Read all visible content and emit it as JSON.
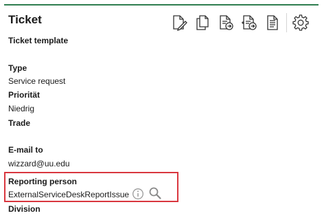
{
  "header": {
    "title": "Ticket",
    "toolbar": [
      {
        "icon": "edit-document-icon"
      },
      {
        "icon": "copy-document-icon"
      },
      {
        "icon": "export-document-icon"
      },
      {
        "icon": "move-document-icon"
      },
      {
        "icon": "report-document-icon"
      },
      {
        "icon": "gear-icon"
      }
    ]
  },
  "fields": {
    "ticket_template": {
      "label": "Ticket template",
      "value": ""
    },
    "type": {
      "label": "Type",
      "value": "Service request"
    },
    "priority": {
      "label": "Priorität",
      "value": "Niedrig"
    },
    "trade": {
      "label": "Trade",
      "value": ""
    },
    "email_to": {
      "label": "E-mail to",
      "value": "wizzard@uu.edu"
    },
    "reporting_person": {
      "label": "Reporting person",
      "value": "ExternalServiceDeskReportIssue"
    },
    "division": {
      "label": "Division",
      "value": ""
    }
  },
  "colors": {
    "accent_rule": "#2e7d4f",
    "highlight_border": "#d9363e",
    "icon_stroke": "#333333",
    "muted_icon": "#9a9a9a"
  }
}
